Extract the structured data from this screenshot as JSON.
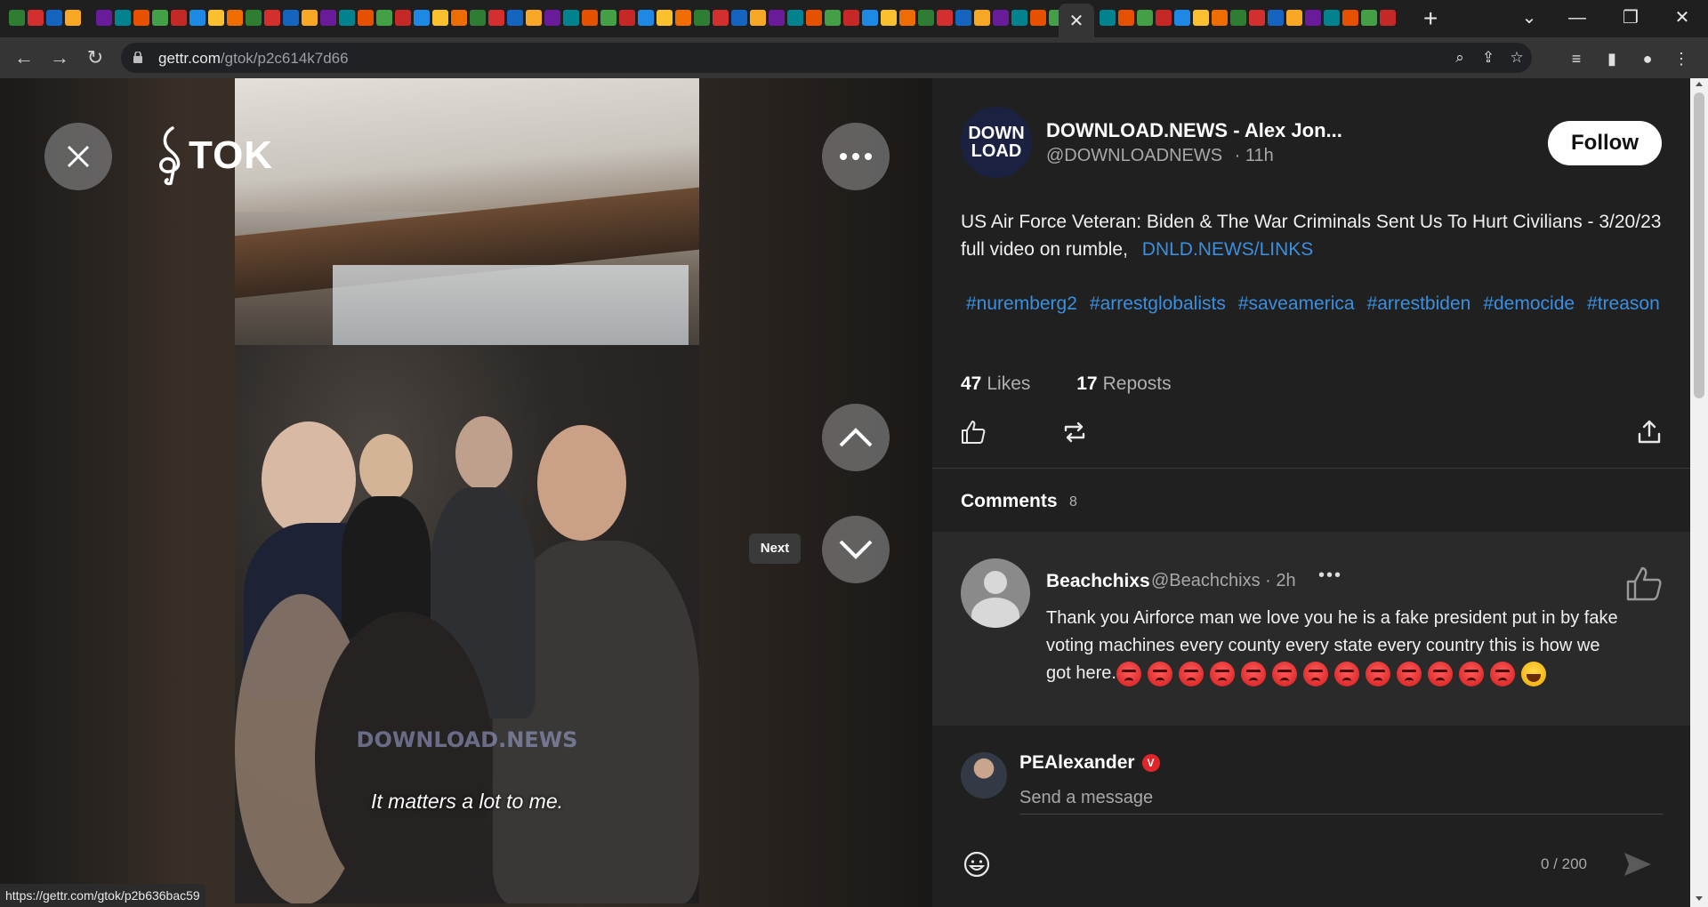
{
  "browser": {
    "url_host": "gettr.com",
    "url_path": "/gtok/p2c614k7d66",
    "active_tab_icon": "close-icon",
    "status_url": "https://gettr.com/gtok/p2b636bac59"
  },
  "player": {
    "logo_text": "TOK",
    "watermark": "DOWNLOAD.NEWS",
    "caption": "It matters a lot to me.",
    "next_tooltip": "Next"
  },
  "post": {
    "author_name": "DOWNLOAD.NEWS - Alex Jon...",
    "author_handle": "@DOWNLOADNEWS",
    "time": "· 11h",
    "avatar_line1": "DOWN",
    "avatar_line2": "LOAD",
    "follow_label": "Follow",
    "text_line1": "US Air Force Veteran: Biden & The War Criminals Sent Us To Hurt Civilians - 3/20/23",
    "text_line2": "full video on rumble,",
    "link": "DNLD.NEWS/LINKS",
    "hashtags": [
      "#nuremberg2",
      "#arrestglobalists",
      "#saveamerica",
      "#arrestbiden",
      "#democide",
      "#treason"
    ],
    "likes_count": "47",
    "likes_label": "Likes",
    "reposts_count": "17",
    "reposts_label": "Reposts"
  },
  "comments": {
    "title": "Comments",
    "count": "8",
    "items": [
      {
        "name": "Beachchixs",
        "handle": "@Beachchixs · 2h",
        "text": "Thank you Airforce man we love you he is a fake president put in by fake voting machines every county every state every country this is how we got here.",
        "emojis": [
          "angry",
          "angry",
          "angry",
          "angry",
          "angry",
          "angry",
          "angry",
          "angry",
          "angry",
          "angry",
          "angry",
          "angry",
          "angry",
          "laugh"
        ]
      }
    ]
  },
  "reply": {
    "user_name": "PEAlexander",
    "badge": "V",
    "placeholder": "Send a message",
    "counter": "0 / 200"
  },
  "colors": {
    "accent_link": "#3a8fe0",
    "panel_bg": "#202020",
    "badge_red": "#e0262b"
  }
}
